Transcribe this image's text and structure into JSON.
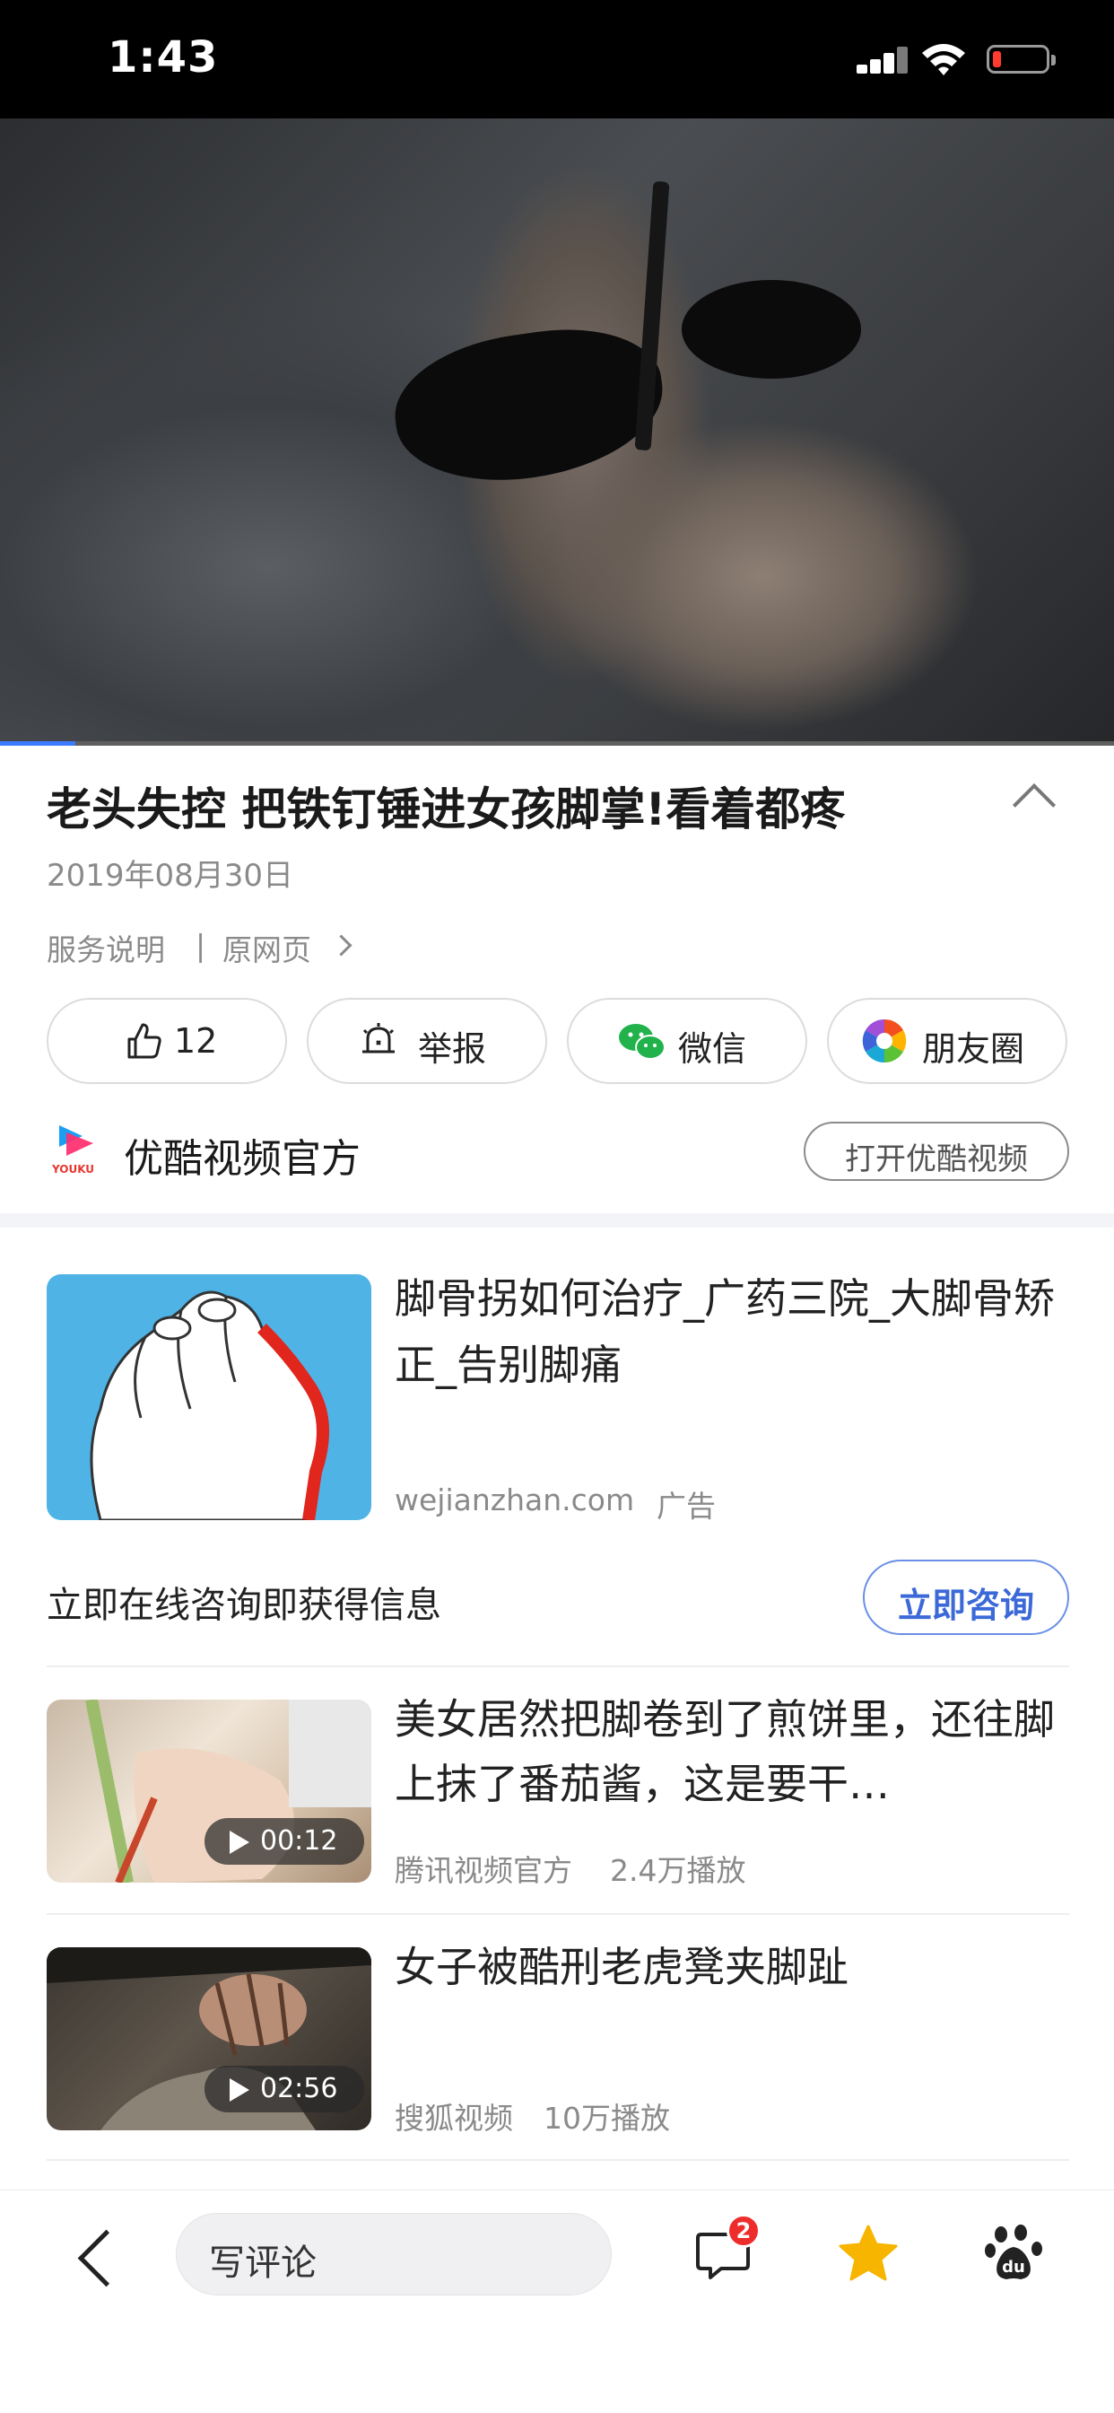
{
  "status_bar": {
    "time": "1:43"
  },
  "video": {
    "progress_fraction": 0.068
  },
  "article": {
    "title": "老头失控 把铁钉锤进女孩脚掌!看着都疼",
    "date": "2019年08月30日",
    "service_link": "服务说明",
    "separator": "|",
    "original_link": "原网页"
  },
  "actions": [
    {
      "icon": "thumbs-up-icon",
      "label": "12"
    },
    {
      "icon": "report-bell-icon",
      "label": "举报"
    },
    {
      "icon": "wechat-icon",
      "label": "微信"
    },
    {
      "icon": "moments-icon",
      "label": "朋友圈"
    }
  ],
  "source": {
    "logo_text": "YOUKU",
    "name": "优酷视频官方",
    "open_button": "打开优酷视频"
  },
  "ad": {
    "title": "脚骨拐如何治疗_广药三院_大脚骨矫正_告别脚痛",
    "site": "wejianzhan.com",
    "tag": "广告",
    "cta_text": "立即在线咨询即获得信息",
    "cta_button": "立即咨询"
  },
  "list": [
    {
      "title": "美女居然把脚卷到了煎饼里，还往脚上抹了番茄酱，这是要干…",
      "duration": "00:12",
      "source": "腾讯视频官方",
      "plays": "2.4万播放"
    },
    {
      "title": "女子被酷刑老虎凳夹脚趾",
      "duration": "02:56",
      "source": "搜狐视频",
      "plays": "10万播放"
    }
  ],
  "bottom_bar": {
    "comment_placeholder": "写评论",
    "comment_badge": "2"
  },
  "colors": {
    "accent_blue": "#3b69d8",
    "badge_red": "#ee2c2c",
    "star_yellow": "#f7b500",
    "ad_thumb_bg": "#4fb3e6"
  }
}
